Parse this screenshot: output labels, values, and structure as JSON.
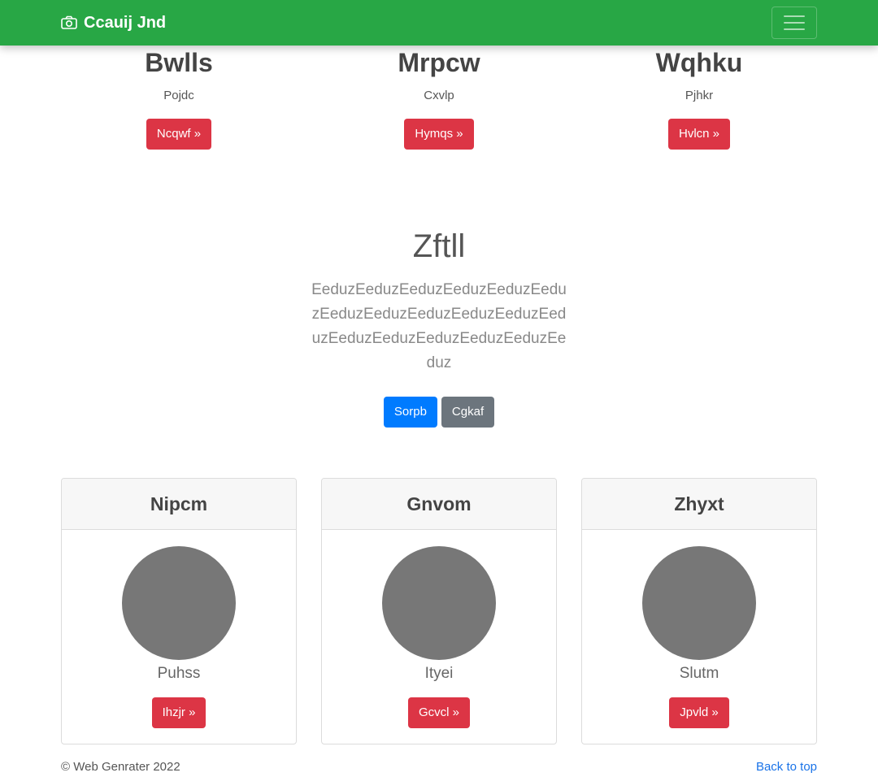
{
  "navbar": {
    "brand": "Ccauij Jnd",
    "brand_icon": "camera-icon",
    "toggler_icon": "hamburger-menu-icon",
    "bg_color": "#28a745"
  },
  "features": [
    {
      "title": "Bwlls",
      "text": "Pojdc",
      "button": "Ncqwf »"
    },
    {
      "title": "Mrpcw",
      "text": "Cxvlp",
      "button": "Hymqs »"
    },
    {
      "title": "Wqhku",
      "text": "Pjhkr",
      "button": "Hvlcn »"
    }
  ],
  "jumbotron": {
    "heading": "Zftll",
    "lead": "EeduzEeduzEeduzEeduzEeduzEeduzEeduzEeduzEeduzEeduzEeduzEeduzEeduzEeduzEeduzEeduzEeduzEeduz",
    "primary_button": "Sorpb",
    "secondary_button": "Cgkaf"
  },
  "cards": [
    {
      "header": "Nipcm",
      "title": "Puhss",
      "button": "Ihzjr »"
    },
    {
      "header": "Gnvom",
      "title": "Ityei",
      "button": "Gcvcl »"
    },
    {
      "header": "Zhyxt",
      "title": "Slutm",
      "button": "Jpvld »"
    }
  ],
  "footer": {
    "copyright": "© Web Genrater 2022",
    "back_to_top": "Back to top"
  },
  "colors": {
    "danger": "#dc3545",
    "primary": "#007bff",
    "secondary": "#6c757d",
    "link": "#1a73e8"
  }
}
